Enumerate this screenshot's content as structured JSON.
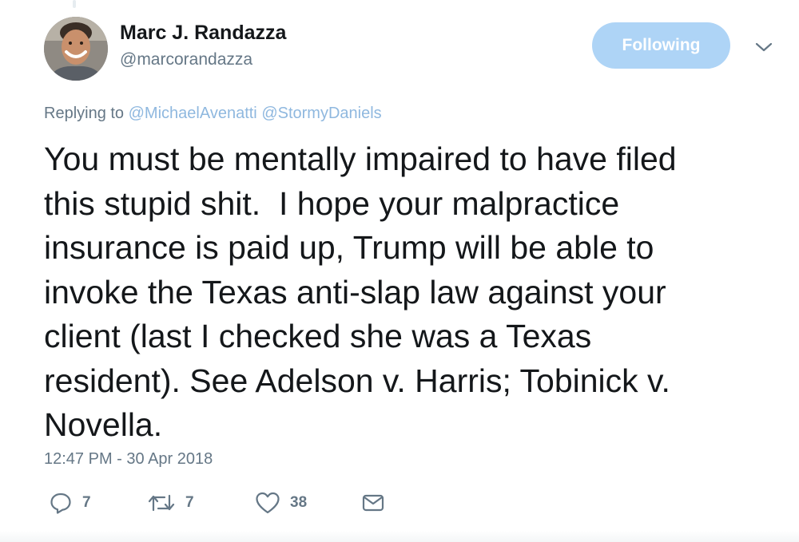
{
  "author": {
    "display_name": "Marc J. Randazza",
    "handle": "@marcorandazza",
    "avatar_icon": "profile-photo"
  },
  "follow_button": {
    "label": "Following"
  },
  "more_menu": {
    "icon": "chevron-down-icon"
  },
  "reply_context": {
    "prefix": "Replying to",
    "mentions": [
      "@MichaelAvenatti",
      "@StormyDaniels"
    ]
  },
  "tweet": {
    "lines": [
      "You must be mentally impaired to have filed",
      "this stupid shit.  I hope your malpractice",
      "insurance is paid up, Trump will be able to",
      "invoke the Texas anti-slap law against your",
      "client (last I checked she was a Texas",
      "resident). See Adelson v. Harris; Tobinick v.",
      "Novella."
    ],
    "timestamp": "12:47 PM - 30 Apr 2018"
  },
  "actions": {
    "reply": {
      "icon": "reply-icon",
      "count": "7"
    },
    "retweet": {
      "icon": "retweet-icon",
      "count": "7"
    },
    "like": {
      "icon": "heart-icon",
      "count": "38"
    },
    "direct_message": {
      "icon": "envelope-icon"
    }
  },
  "colors": {
    "text": "#14171a",
    "secondary_text": "#657786",
    "mention_link": "#8fb8df",
    "following_button_bg": "#aed4f6"
  }
}
